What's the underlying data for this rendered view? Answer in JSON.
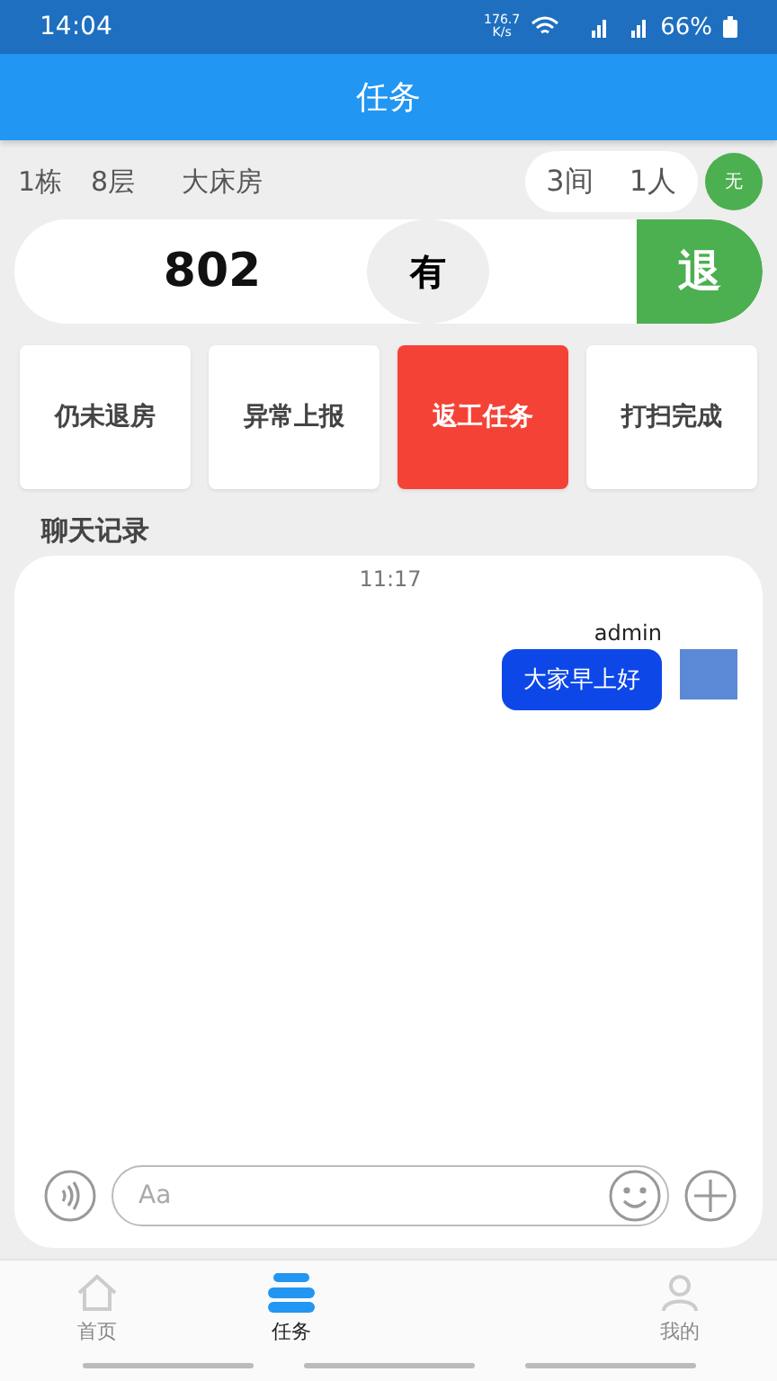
{
  "status_bar": {
    "time": "14:04",
    "speed": "176.7",
    "speed_unit": "K/s",
    "battery": "66%"
  },
  "header": {
    "title": "任务"
  },
  "room_info": {
    "building": "1栋",
    "floor": "8层",
    "room_type": "大床房",
    "rooms": "3间",
    "people": "1人",
    "badge": "无"
  },
  "room_card": {
    "number": "802",
    "status": "有",
    "action": "退"
  },
  "actions": [
    {
      "label": "仍未退房",
      "selected": false
    },
    {
      "label": "异常上报",
      "selected": false
    },
    {
      "label": "返工任务",
      "selected": true
    },
    {
      "label": "打扫完成",
      "selected": false
    }
  ],
  "chat": {
    "title": "聊天记录",
    "time": "11:17",
    "messages": [
      {
        "sender": "admin",
        "text": "大家早上好"
      }
    ],
    "input": {
      "placeholder": "Aa"
    }
  },
  "tab_bar": [
    {
      "label": "首页",
      "kind": "home",
      "selected": false
    },
    {
      "label": "任务",
      "kind": "tasks",
      "selected": true
    },
    {
      "label": "我的",
      "kind": "user",
      "selected": false
    }
  ]
}
